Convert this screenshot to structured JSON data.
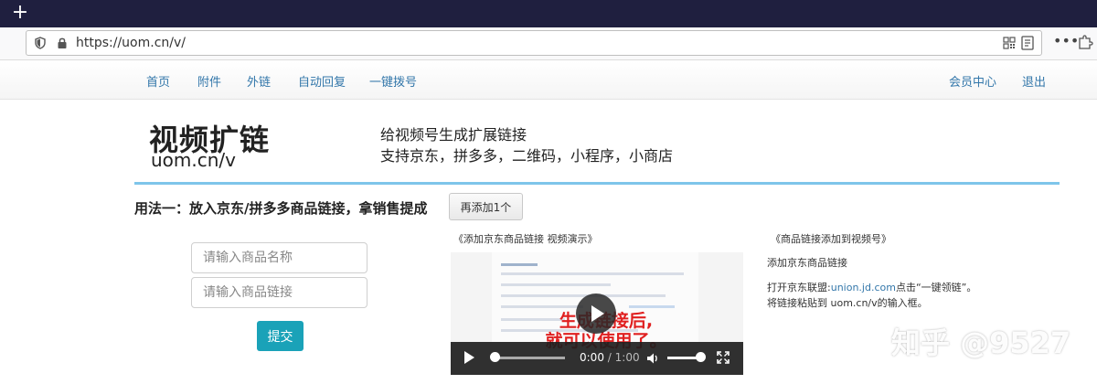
{
  "browser": {
    "url": "https://uom.cn/v/",
    "new_tab": "+"
  },
  "nav": {
    "items": [
      "首页",
      "附件",
      "外链",
      "自动回复",
      "一键拨号"
    ],
    "member_center": "会员中心",
    "logout": "退出"
  },
  "header": {
    "title": "视频扩链",
    "subtitle": "uom.cn/v",
    "tagline1": "给视频号生成扩展链接",
    "tagline2": "支持京东，拼多多，二维码，小程序，小商店"
  },
  "usage": {
    "heading": "用法一：放入京东/拼多多商品链接，拿销售提成",
    "add_button": "再添加1个"
  },
  "form": {
    "name_placeholder": "请输入商品名称",
    "link_placeholder": "请输入商品链接",
    "submit": "提交"
  },
  "video": {
    "caption": "《添加京东商品链接 视频演示》",
    "overlay_line1": "生成链接后,",
    "overlay_line2": "就可以使用了。",
    "current_time": "0:00",
    "duration": "/ 1:00",
    "progress": 0.0,
    "volume": 1.0
  },
  "right": {
    "title": "《商品链接添加到视频号》",
    "subtitle": "添加京东商品链接",
    "line1_prefix": "打开京东联盟:",
    "line1_link": "union.jd.com",
    "line1_suffix": "点击“一键领链”。",
    "line2": "将链接粘贴到 uom.cn/v的输入框。"
  },
  "watermark": "知乎 @9527",
  "colors": {
    "tabstrip": "#1f1f3f",
    "link": "#3377aa",
    "accent_line": "#7ec5ea",
    "submit": "#1aa2b8",
    "overlay_text": "#e02020"
  }
}
